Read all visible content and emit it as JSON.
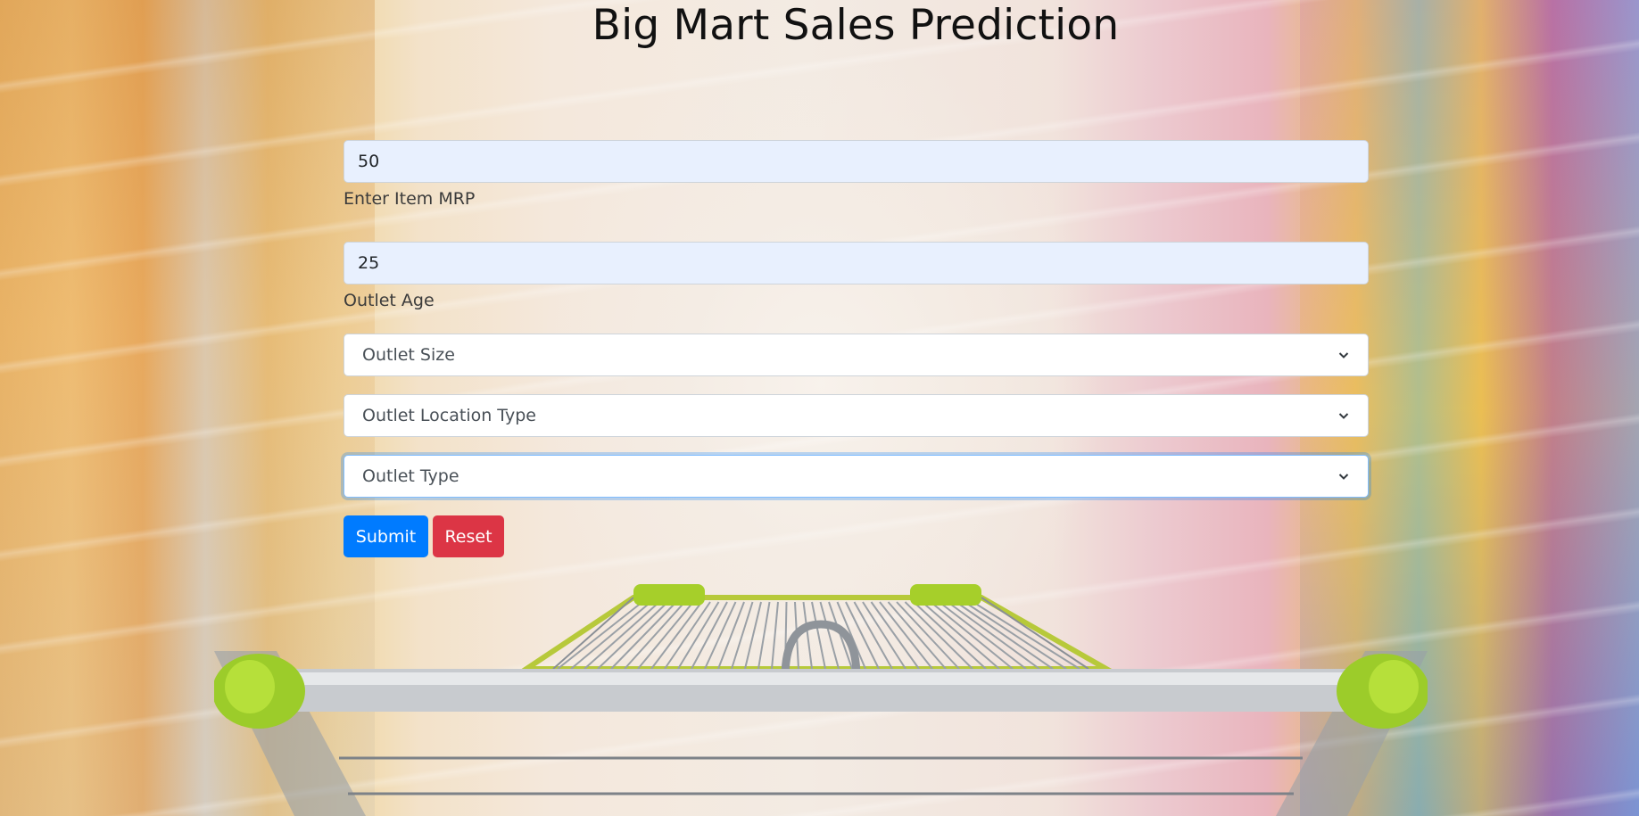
{
  "page": {
    "title": "Big Mart Sales Prediction"
  },
  "form": {
    "item_mrp": {
      "value": "50",
      "label": "Enter Item MRP"
    },
    "outlet_age": {
      "value": "25",
      "label": "Outlet Age"
    },
    "outlet_size": {
      "selected": "Outlet Size"
    },
    "outlet_location_type": {
      "selected": "Outlet Location Type"
    },
    "outlet_type": {
      "selected": "Outlet Type"
    },
    "submit_label": "Submit",
    "reset_label": "Reset"
  },
  "colors": {
    "primary": "#007bff",
    "danger": "#dc3545",
    "input_autofill_bg": "#e8f0fe",
    "focus_ring": "#80bdff"
  },
  "icons": {
    "select_arrow": "chevron-down-icon"
  }
}
